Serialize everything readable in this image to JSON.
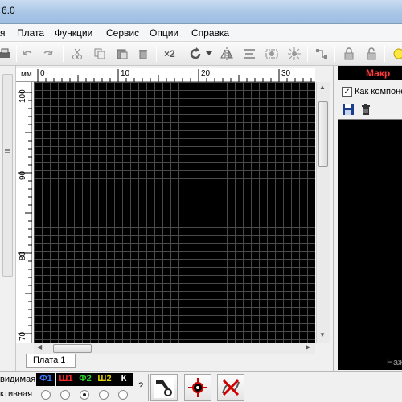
{
  "window": {
    "title_fragment": "6.0"
  },
  "menu": {
    "items": [
      "я",
      "Плата",
      "Функции",
      "Сервис",
      "Опции",
      "Справка"
    ]
  },
  "toolbar": {
    "x2_label": "×2"
  },
  "ruler": {
    "unit": "мм",
    "top_labels": [
      "0",
      "10",
      "20",
      "30"
    ],
    "left_labels": [
      "100",
      "90",
      "80",
      "70"
    ]
  },
  "board_tabs": [
    "Плата 1"
  ],
  "right_panel": {
    "title": "Макр",
    "checkbox_label": "Как компоне",
    "checkbox_checked": true,
    "hint": "Наж"
  },
  "layers": {
    "visible_label": "видимая",
    "active_label": "ктивная",
    "help": "?",
    "items": [
      {
        "label": "Ф1",
        "color": "#3a7bff"
      },
      {
        "label": "Ш1",
        "color": "#ff2a2a"
      },
      {
        "label": "Ф2",
        "color": "#2fd12f"
      },
      {
        "label": "Ш2",
        "color": "#e0d200"
      },
      {
        "label": "К",
        "color": "#ffffff"
      }
    ],
    "active_index": 2
  },
  "colors": {
    "canvas": "#000000",
    "grid": "#4a4a4a",
    "accent_red": "#ff3b3b"
  }
}
